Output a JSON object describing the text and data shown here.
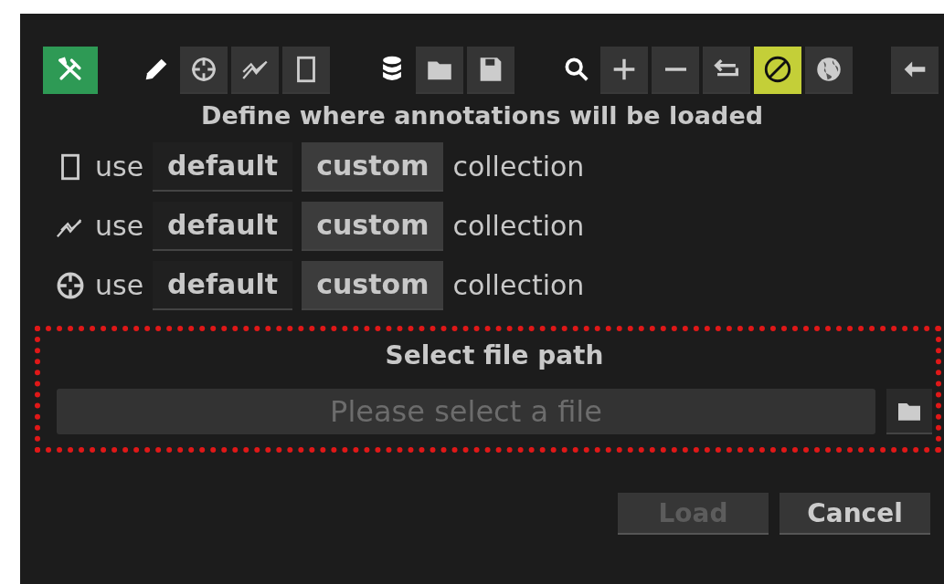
{
  "toolbar": [
    {
      "selected": true
    },
    {
      "selected": false
    },
    {
      "selected": false
    },
    {
      "selected": false
    },
    {
      "selected": false
    },
    {
      "selected": false
    },
    {
      "selected": false
    },
    {
      "selected": false
    },
    {
      "selected": false
    },
    {
      "selected": false
    },
    {
      "selected": false
    },
    {
      "selected": false
    },
    {
      "selected": true
    },
    {
      "selected": false
    },
    {
      "selected": false
    }
  ],
  "heading": "Define where annotations will be loaded",
  "collections": [
    {
      "kind": "rectangle",
      "use": "use",
      "options": [
        {
          "label": "default",
          "selected": false
        },
        {
          "label": "custom",
          "selected": true
        }
      ],
      "suffix": "collection"
    },
    {
      "kind": "line",
      "use": "use",
      "options": [
        {
          "label": "default",
          "selected": false
        },
        {
          "label": "custom",
          "selected": true
        }
      ],
      "suffix": "collection"
    },
    {
      "kind": "target",
      "use": "use",
      "options": [
        {
          "label": "default",
          "selected": false
        },
        {
          "label": "custom",
          "selected": true
        }
      ],
      "suffix": "collection"
    }
  ],
  "file": {
    "title": "Select file path",
    "placeholder": "Please select a file"
  },
  "buttons": [
    {
      "label": "Load",
      "disabled": true
    },
    {
      "label": "Cancel",
      "disabled": false
    }
  ]
}
